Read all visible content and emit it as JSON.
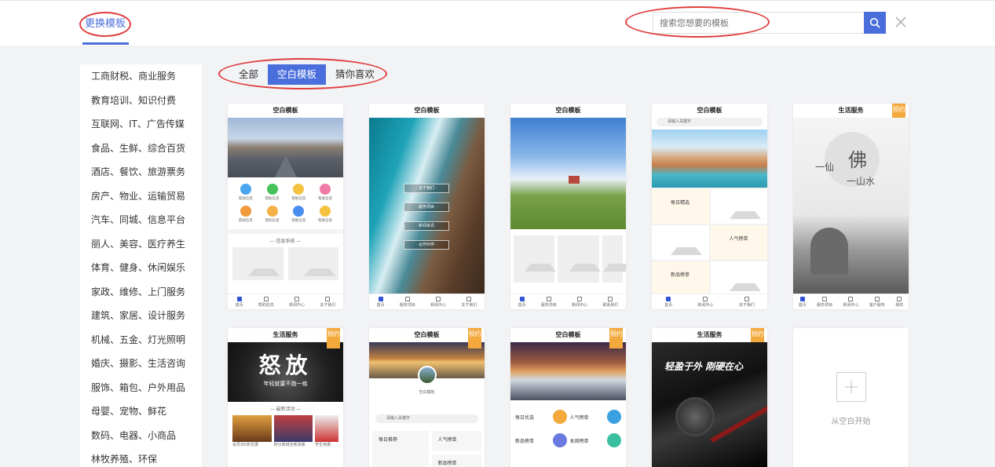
{
  "header": {
    "tab_label": "更换模板",
    "search_placeholder": "搜索您想要的模板"
  },
  "sidebar": {
    "items": [
      "工商财税、商业服务",
      "教育培训、知识付费",
      "互联网、IT、广告传媒",
      "食品、生鲜、综合百货",
      "酒店、餐饮、旅游票务",
      "房产、物业、运输贸易",
      "汽车、同城、信息平台",
      "丽人、美容、医疗养生",
      "体育、健身、休闲娱乐",
      "家政、维修、上门服务",
      "建筑、家居、设计服务",
      "机械、五金、灯光照明",
      "婚庆、摄影、生活咨询",
      "服饰、箱包、户外用品",
      "母婴、宠物、鲜花",
      "数码、电器、小商品",
      "林牧养殖、环保"
    ]
  },
  "filters": {
    "all": "全部",
    "blank": "空白模板",
    "guess": "猜你喜欢"
  },
  "cards": {
    "c1": {
      "title": "空白模板",
      "section": "— 信息系统 —",
      "tabs": [
        "首页",
        "帮助信息",
        "新闻中心",
        "关于我们"
      ]
    },
    "c2": {
      "title": "空白模板",
      "buttons": [
        "· 关于我们 ·",
        "· 服务项目 ·",
        "· 新闻资讯 ·",
        "· 合作伙伴 ·"
      ],
      "tabs": [
        "首页",
        "服务项目",
        "新闻中心",
        "关于我们"
      ]
    },
    "c3": {
      "title": "空白模板",
      "tabs": [
        "首页",
        "服务项目",
        "新闻中心",
        "联系我们"
      ]
    },
    "c4": {
      "title": "空白模板",
      "search": "请输入关键字",
      "labels": [
        "每日精选",
        "人气榜单",
        "新品榜单"
      ],
      "tabs": [
        "首页",
        "新闻中心",
        "关于我们"
      ]
    },
    "c5": {
      "title": "生活服务",
      "ribbon": "预约",
      "poster_main": "佛",
      "poster_a": "一仙",
      "poster_b": "一山水",
      "tabs": [
        "首页",
        "服务项目",
        "新闻中心",
        "客户服务",
        "我的"
      ]
    },
    "c6": {
      "title": "生活服务",
      "ribbon": "预约",
      "poster": "怒放",
      "poster_sub": "年轻就要不抱一格",
      "section": "— 最新活动 —",
      "thumbs": [
        "会员日5折优惠",
        "积分商城全新改版",
        "学生特惠"
      ]
    },
    "c7": {
      "title": "空白模板",
      "ribbon": "预约",
      "avatar_label": "空白模板",
      "search": "请输入关键字",
      "labels": [
        "每日推荐",
        "人气榜单",
        "新品榜单"
      ]
    },
    "c8": {
      "title": "空白模板",
      "ribbon": "预约",
      "labels": [
        "每日优选",
        "人气榜单",
        "新品榜单",
        "本周榜单"
      ]
    },
    "c9": {
      "title": "生活服务",
      "ribbon": "预约",
      "poster": "轻盈于外 刚硬在心"
    },
    "blank": {
      "label": "从空白开始"
    }
  },
  "colors": {
    "accent": "#4a6fdc",
    "ribbon": "#f3a93b",
    "annotation": "#e03c3c"
  }
}
